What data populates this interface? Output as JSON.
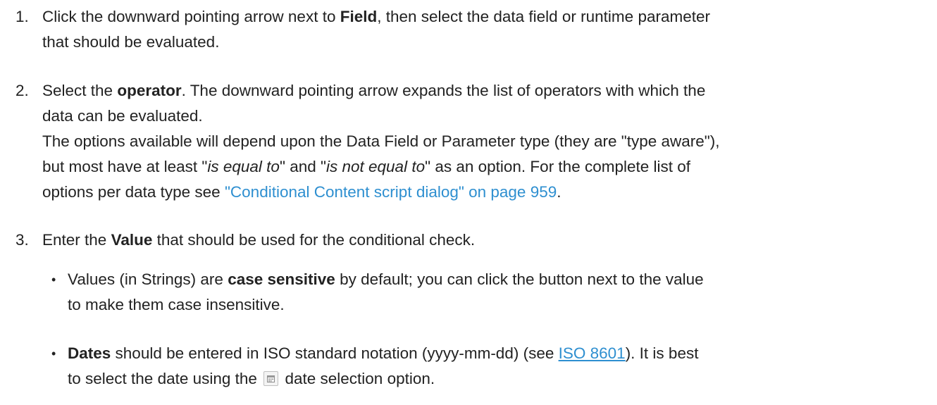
{
  "steps": [
    {
      "number": "1.",
      "text_1": "Click the downward pointing arrow next to ",
      "bold_1": "Field",
      "text_2": ", then select the data field or runtime parameter",
      "line_2": "that should be evaluated."
    },
    {
      "number": "2.",
      "text_1": "Select the ",
      "bold_1": "operator",
      "text_2": ". The downward pointing arrow expands the list of operators with which the",
      "line_2": "data can be evaluated.",
      "line_3": "The options available will depend upon the Data Field or Parameter type (they are \"type aware\"),",
      "line_4_a": "but most have at least \"",
      "line_4_i1": "is equal to",
      "line_4_b": "\" and \"",
      "line_4_i2": "is not equal to",
      "line_4_c": "\" as an option. For the complete list of",
      "line_5_a": "options per data type see ",
      "line_5_link": "\"Conditional Content script dialog\" on page 959",
      "line_5_b": "."
    },
    {
      "number": "3.",
      "text_1": "Enter the ",
      "bold_1": "Value",
      "text_2": " that should be used for the conditional check."
    }
  ],
  "bullets": [
    {
      "marker": "•",
      "text_1": "Values (in Strings) are ",
      "bold_1": "case sensitive",
      "text_2": " by default; you can click the button next to the value",
      "line_2": "to make them case insensitive."
    },
    {
      "marker": "•",
      "bold_1": "Dates",
      "text_1": " should be entered in ISO standard notation (yyyy-mm-dd) (see ",
      "link": "ISO 8601",
      "text_2": "). It is best",
      "line_2_a": "to select the date using the",
      "line_2_b": "date selection option.",
      "icon": "calendar-icon"
    }
  ],
  "colors": {
    "text": "#222222",
    "link": "#2e8fd0"
  }
}
